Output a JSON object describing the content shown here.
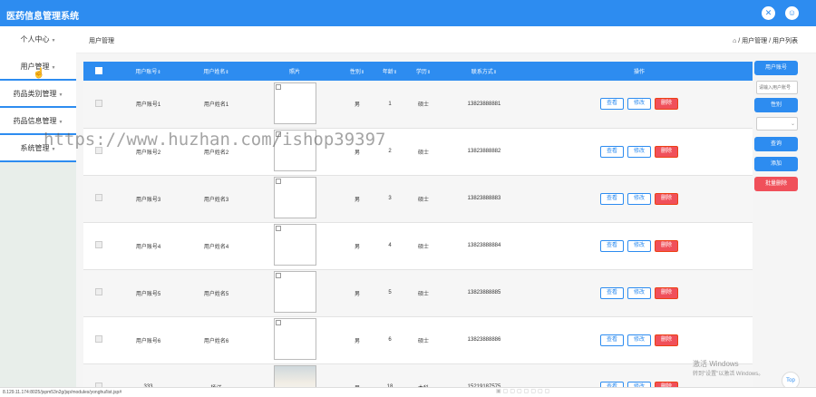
{
  "header": {
    "title": "医药信息管理系统",
    "icon1": "tools-icon",
    "icon2": "user-icon"
  },
  "sidebar": {
    "items": [
      {
        "label": "个人中心"
      },
      {
        "label": "用户管理"
      },
      {
        "label": "药品类别管理"
      },
      {
        "label": "药品信息管理"
      },
      {
        "label": "系统管理"
      }
    ]
  },
  "breadcrumb": {
    "page_label": "用户管理",
    "home_icon": "home-icon",
    "path": "/ 用户管理 / 用户列表"
  },
  "table": {
    "headers": [
      "用户账号",
      "用户姓名",
      "照片",
      "性别",
      "年龄",
      "学历",
      "联系方式",
      "操作"
    ],
    "rows": [
      {
        "account": "用户账号1",
        "name": "用户姓名1",
        "gender": "男",
        "age": "1",
        "edu": "硕士",
        "phone": "13823888881"
      },
      {
        "account": "用户账号2",
        "name": "用户姓名2",
        "gender": "男",
        "age": "2",
        "edu": "硕士",
        "phone": "13823888882"
      },
      {
        "account": "用户账号3",
        "name": "用户姓名3",
        "gender": "男",
        "age": "3",
        "edu": "硕士",
        "phone": "13823888883"
      },
      {
        "account": "用户账号4",
        "name": "用户姓名4",
        "gender": "男",
        "age": "4",
        "edu": "硕士",
        "phone": "13823888884"
      },
      {
        "account": "用户账号5",
        "name": "用户姓名5",
        "gender": "男",
        "age": "5",
        "edu": "硕士",
        "phone": "13823888885"
      },
      {
        "account": "用户账号6",
        "name": "用户姓名6",
        "gender": "男",
        "age": "6",
        "edu": "硕士",
        "phone": "13823888886"
      },
      {
        "account": "333",
        "name": "杨洋",
        "gender": "男",
        "age": "18",
        "edu": "本科",
        "phone": "15219187575"
      }
    ],
    "actions": {
      "view": "查看",
      "edit": "修改",
      "delete": "删除"
    }
  },
  "search_panel": {
    "account_label": "用户账号",
    "account_placeholder": "请输入用户账号",
    "gender_label": "性别",
    "query_button": "查询",
    "add_button": "添加",
    "batch_delete_button": "批量删除"
  },
  "status": {
    "url": "8.129.11.174:8025/jspm53n2g/jsp/modules/yonghu/list.jsp#"
  },
  "overlay": {
    "watermark": "https://www.huzhan.com/ishop39397",
    "activate_title": "激活 Windows",
    "activate_sub": "转到\"设置\"以激活 Windows。",
    "top_button": "Top"
  },
  "colors": {
    "primary": "#2d8cf0",
    "danger": "#f0505a"
  }
}
